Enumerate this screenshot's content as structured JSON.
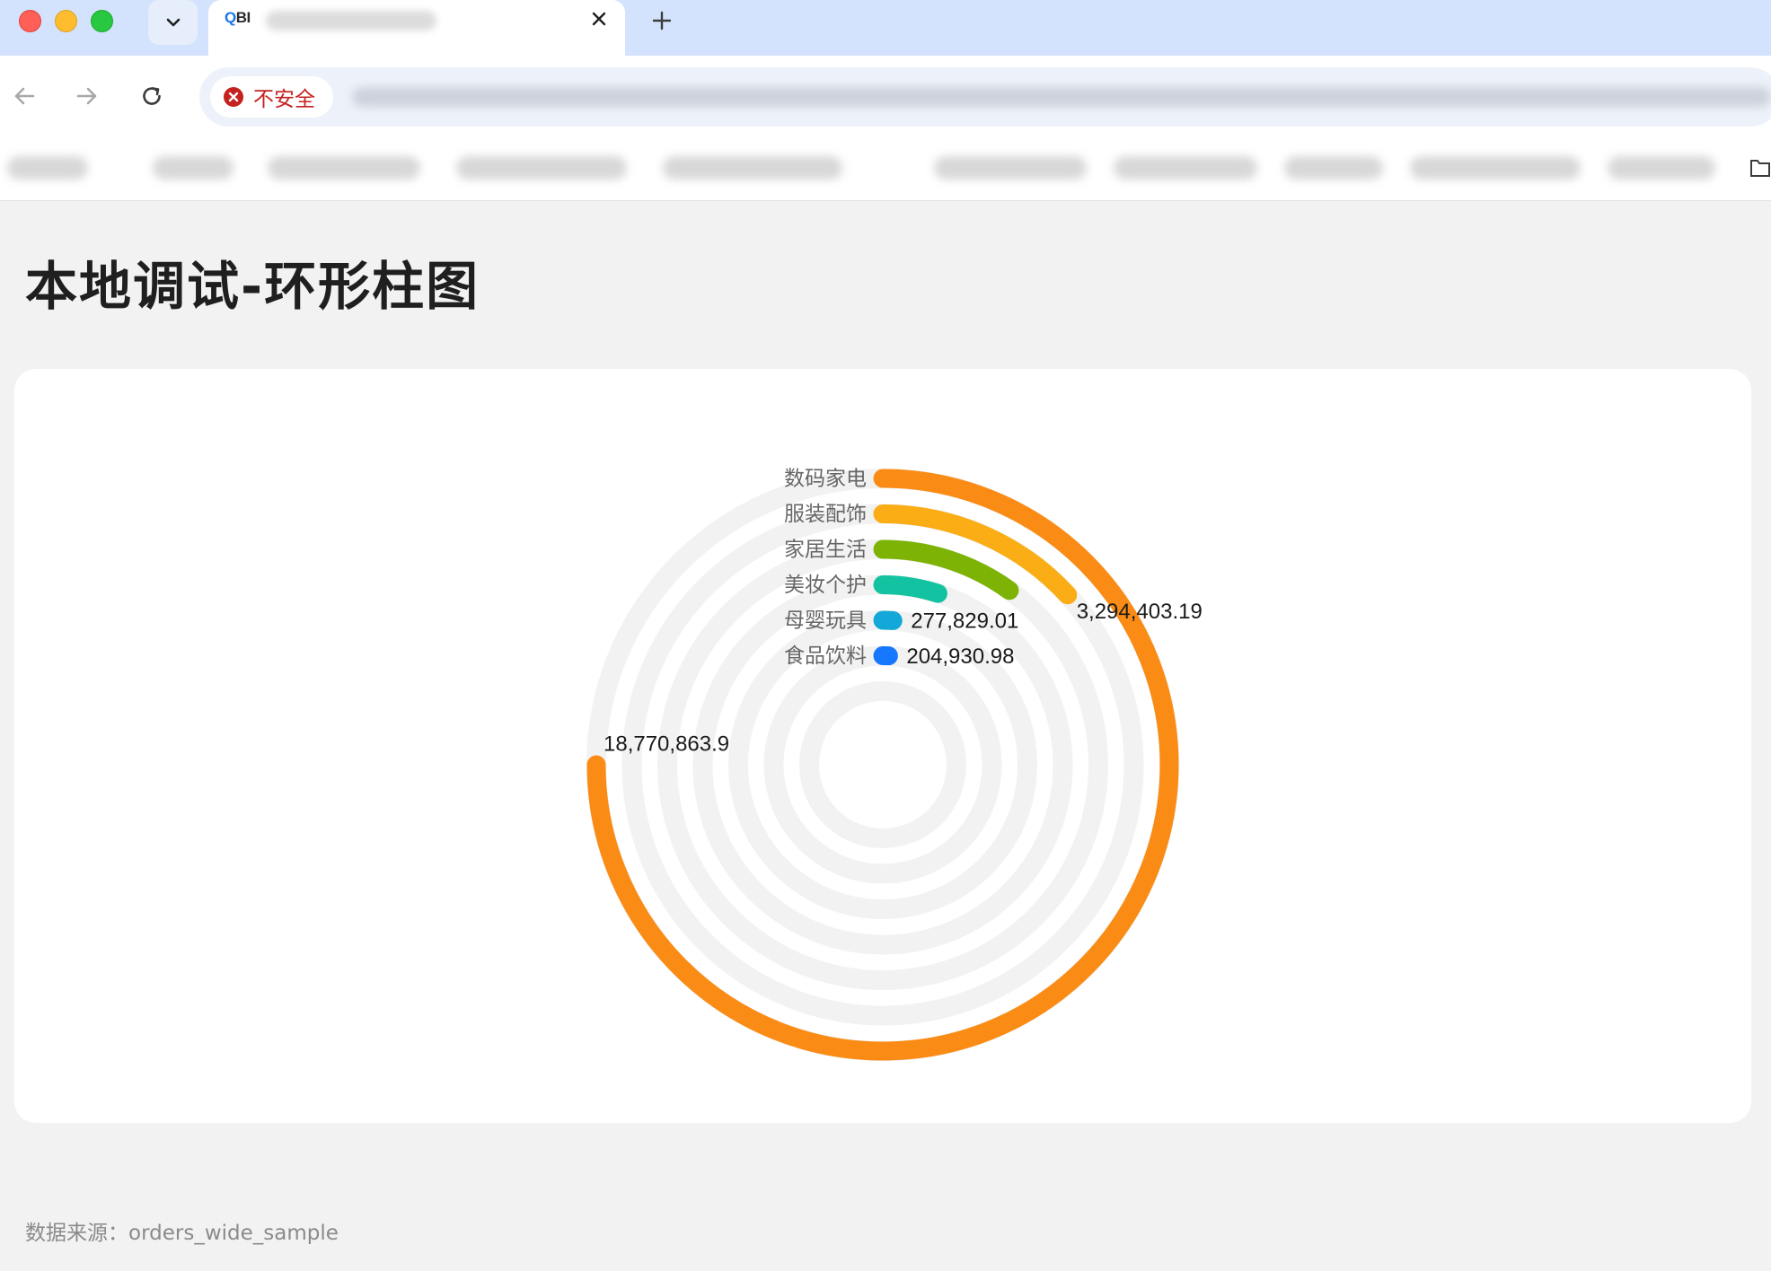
{
  "browser": {
    "tab_favicon_q": "Q",
    "tab_favicon_bi": "BI",
    "security_label": "不安全"
  },
  "page": {
    "title": "本地调试-环形柱图",
    "footer_label": "数据来源：",
    "footer_source": "orders_wide_sample"
  },
  "colors": {
    "track": "#f2f2f2",
    "label": "#666666",
    "value": "#1a1a1a"
  },
  "chart_data": {
    "type": "radial-bar",
    "title": "",
    "max_value": 18770863.9,
    "series": [
      {
        "category": "数码家电",
        "value": 18770863.9,
        "value_label": "18,770,863.9",
        "color": "#fa8c16"
      },
      {
        "category": "服装配饰",
        "value": 3294403.19,
        "value_label": "3,294,403.19",
        "color": "#faad14"
      },
      {
        "category": "家居生活",
        "value": 2500000,
        "value_label": "",
        "color": "#7cb305"
      },
      {
        "category": "美妆个护",
        "value": 1240000,
        "value_label": "",
        "color": "#13c2a0"
      },
      {
        "category": "母婴玩具",
        "value": 277829.01,
        "value_label": "277,829.01",
        "color": "#13a8d8"
      },
      {
        "category": "食品饮料",
        "value": 204930.98,
        "value_label": "204,930.98",
        "color": "#1677ff"
      }
    ]
  }
}
